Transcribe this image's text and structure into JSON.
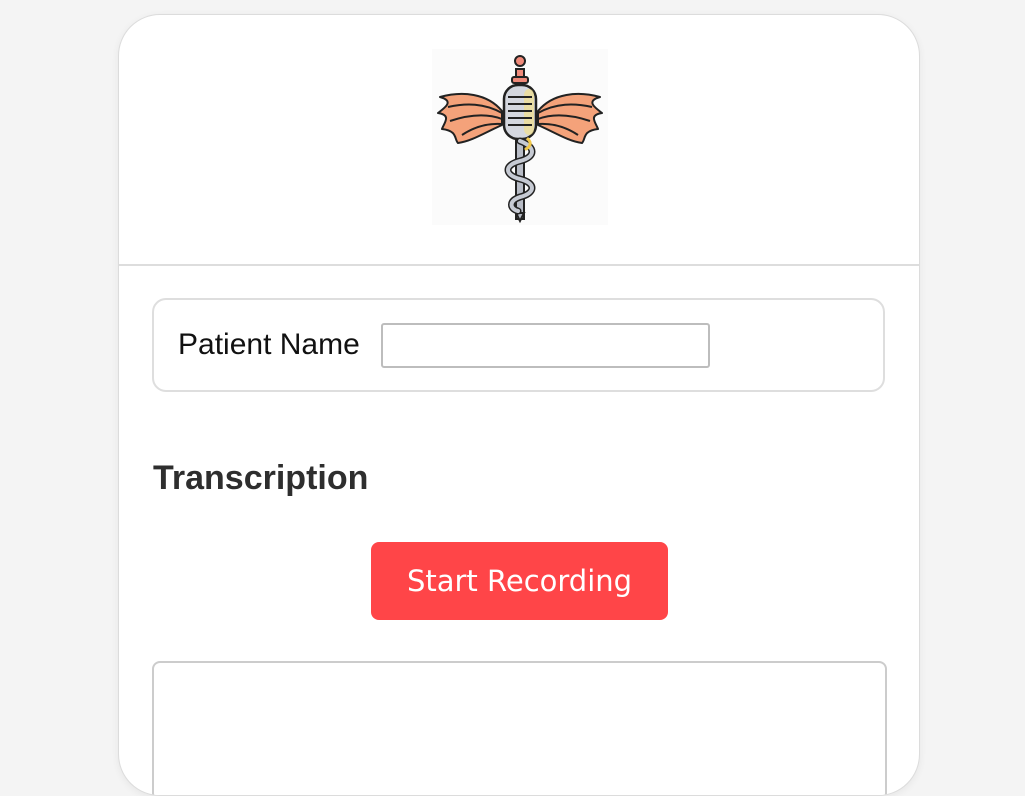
{
  "logo": {
    "icon": "caduceus-microphone-logo",
    "wing_color": "#f4a27a",
    "wing_accent": "#e8866a",
    "mic_color": "#c9cdd6",
    "cap_color": "#f08a7a"
  },
  "patient": {
    "label": "Patient Name",
    "value": "",
    "placeholder": ""
  },
  "transcription": {
    "title": "Transcription",
    "record_button_label": "Start Recording",
    "record_button_color": "#ff4548",
    "text": ""
  }
}
